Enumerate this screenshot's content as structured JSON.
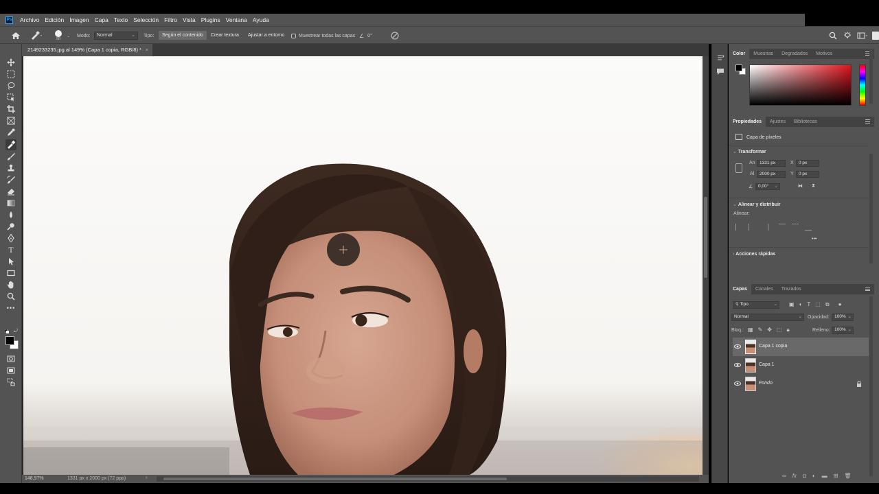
{
  "app": {
    "logo": "Ps",
    "menu": [
      "Archivo",
      "Edición",
      "Imagen",
      "Capa",
      "Texto",
      "Selección",
      "Filtro",
      "Vista",
      "Plugins",
      "Ventana",
      "Ayuda"
    ]
  },
  "options": {
    "brush_size": "50",
    "mode_label": "Modo:",
    "mode_value": "Normal",
    "type_label": "Tipo:",
    "type_buttons": [
      "Según el contenido",
      "Crear textura",
      "Ajustar a entorno"
    ],
    "sample_all_label": "Muestrear todas las capas",
    "angle_value": "0°"
  },
  "document": {
    "tab_title": "2149233235.jpg al 149% (Capa 1 copia, RGB/8) *",
    "close": "×",
    "zoom": "148,97%",
    "doc_info": "1331 px x 2000 px (72 ppp)",
    "status_arrow": "›"
  },
  "color_panel": {
    "tabs": [
      "Color",
      "Muestras",
      "Degradados",
      "Motivos"
    ],
    "hue_color": "#e1141e"
  },
  "properties_panel": {
    "tabs": [
      "Propiedades",
      "Ajustes",
      "Bibliotecas"
    ],
    "layer_kind": "Capa de píxeles",
    "transform_title": "Transformar",
    "w_label": "An",
    "w_value": "1331 px",
    "h_label": "Al",
    "h_value": "2000 px",
    "x_label": "X",
    "x_value": "0 px",
    "y_label": "Y",
    "y_value": "0 px",
    "angle_value": "0,00°",
    "align_title": "Alinear y distribuir",
    "align_label": "Alinear:",
    "more": "•••",
    "quick_actions_title": "Acciones rápidas"
  },
  "layers_panel": {
    "tabs": [
      "Capas",
      "Canales",
      "Trazados"
    ],
    "filter_value": "Tipo",
    "blend_mode": "Normal",
    "opacity_label": "Opacidad:",
    "opacity_value": "100%",
    "lock_label": "Bloq.:",
    "fill_label": "Relleno:",
    "fill_value": "100%",
    "layers": [
      {
        "name": "Capa 1 copia",
        "selected": true
      },
      {
        "name": "Capa 1",
        "selected": false
      },
      {
        "name": "Fondo",
        "selected": false,
        "locked": true
      }
    ]
  }
}
